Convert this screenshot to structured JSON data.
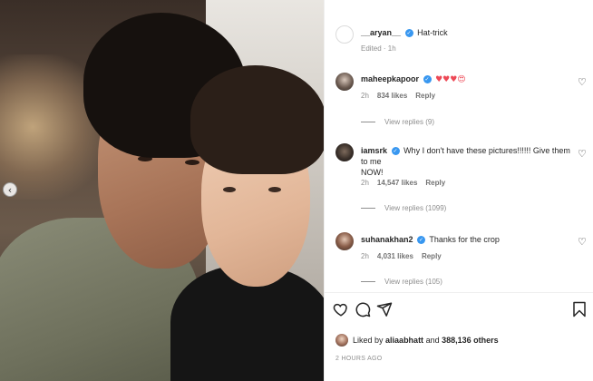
{
  "caption": {
    "username": "__aryan__",
    "text": "Hat-trick",
    "meta": "Edited · 1h"
  },
  "comments": [
    {
      "username": "maheepkapoor",
      "text": "♥♥♥😍",
      "time": "2h",
      "likes": "834 likes",
      "reply": "Reply",
      "view_replies": "View replies (9)"
    },
    {
      "username": "iamsrk",
      "text_line1": "Why I don't have these pictures!!!!!! Give them to me",
      "text_line2": "NOW!",
      "time": "2h",
      "likes": "14,547 likes",
      "reply": "Reply",
      "view_replies": "View replies (1099)"
    },
    {
      "username": "suhanakhan2",
      "text": "Thanks for the crop",
      "time": "2h",
      "likes": "4,031 likes",
      "reply": "Reply",
      "view_replies": "View replies (105)"
    }
  ],
  "likes": {
    "prefix": "Liked by",
    "user": "aliaabhatt",
    "middle": "and",
    "others": "388,136 others"
  },
  "timestamp": "2 HOURS AGO",
  "icons": {
    "carousel_prev": "chevron-left-icon",
    "like": "heart-icon",
    "comment": "comment-icon",
    "share": "paper-plane-icon",
    "save": "bookmark-icon",
    "verified": "verified-badge-icon",
    "comment_like": "heart-outline-icon"
  },
  "colors": {
    "verified": "#3897f0",
    "heart_emoji": "#ed4956",
    "muted_text": "#8e8e8e"
  }
}
